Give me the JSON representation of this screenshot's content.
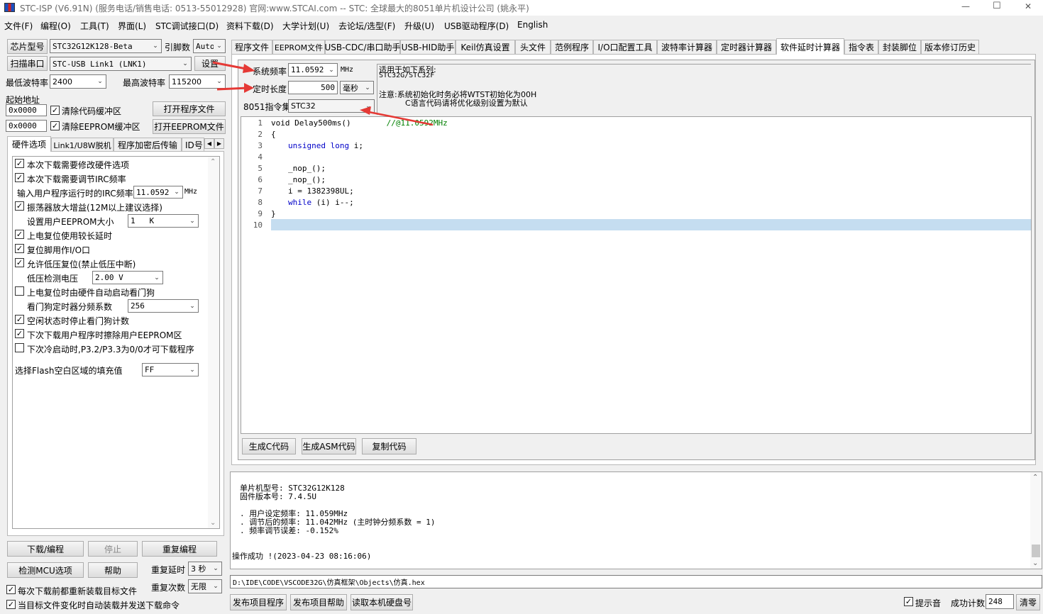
{
  "window": {
    "title": "STC-ISP (V6.91N) (服务电话/销售电话: 0513-55012928) 官网:www.STCAI.com  -- STC: 全球最大的8051单片机设计公司 (姚永平)",
    "minimize": "—",
    "maximize": "☐",
    "close": "✕"
  },
  "menu": [
    "文件(F)",
    "编程(O)",
    "工具(T)",
    "界面(L)",
    "STC调试接口(D)",
    "资料下载(D)",
    "大学计划(U)",
    "去论坛/选型(F)",
    "升级(U)",
    "USB驱动程序(D)",
    "English"
  ],
  "left": {
    "chip_label": "芯片型号",
    "chip_value": "STC32G12K128-Beta",
    "pin_label": "引脚数",
    "pin_value": "Auto",
    "scan_label": "扫描串口",
    "port_value": "STC-USB Link1 (LNK1)",
    "settings_label": "设置",
    "min_baud_label": "最低波特率",
    "min_baud": "2400",
    "max_baud_label": "最高波特率",
    "max_baud": "115200",
    "start_addr_label": "起始地址",
    "addr1": "0x0000",
    "clear_code": "清除代码缓冲区",
    "open_program": "打开程序文件",
    "addr2": "0x0000",
    "clear_eeprom": "清除EEPROM缓冲区",
    "open_eeprom": "打开EEPROM文件",
    "tabs": [
      "硬件选项",
      "Link1/U8W脱机",
      "程序加密后传输",
      "ID号"
    ],
    "options": [
      {
        "label": "本次下载需要修改硬件选项",
        "checked": true
      },
      {
        "label": "本次下载需要调节IRC频率",
        "checked": true
      },
      {
        "label": "输入用户程序运行时的IRC频率",
        "value": "11.0592",
        "unit": "MHz"
      },
      {
        "label": "振荡器放大增益(12M以上建议选择)",
        "checked": true
      },
      {
        "label": "设置用户EEPROM大小",
        "value": "1   K"
      },
      {
        "label": "上电复位使用较长延时",
        "checked": true
      },
      {
        "label": "复位脚用作I/O口",
        "checked": true
      },
      {
        "label": "允许低压复位(禁止低压中断)",
        "checked": true
      },
      {
        "label": "低压检测电压",
        "value": "2.00 V"
      },
      {
        "label": "上电复位时由硬件自动启动看门狗",
        "checked": false
      },
      {
        "label": "看门狗定时器分频系数",
        "value": "256"
      },
      {
        "label": "空闲状态时停止看门狗计数",
        "checked": true
      },
      {
        "label": "下次下载用户程序时擦除用户EEPROM区",
        "checked": true
      },
      {
        "label": "下次冷启动时,P3.2/P3.3为0/0才可下载程序",
        "checked": false
      }
    ],
    "flash_fill_label": "选择Flash空白区域的填充值",
    "flash_fill_value": "FF",
    "download_btn": "下载/编程",
    "stop_btn": "停止",
    "reprogram_btn": "重复编程",
    "detect_btn": "检测MCU选项",
    "help_btn": "帮助",
    "repeat_delay_label": "重复延时",
    "repeat_delay": "3 秒",
    "repeat_count_label": "重复次数",
    "repeat_count": "无限",
    "reload_each": "每次下载前都重新装载目标文件",
    "auto_send": "当目标文件变化时自动装载并发送下载命令"
  },
  "tabs": [
    "程序文件",
    "EEPROM文件",
    "USB-CDC/串口助手",
    "USB-HID助手",
    "Keil仿真设置",
    "头文件",
    "范例程序",
    "I/O口配置工具",
    "波特率计算器",
    "定时器计算器",
    "软件延时计算器",
    "指令表",
    "封装脚位",
    "版本修订历史"
  ],
  "delay": {
    "sysfreq_label": "系统频率",
    "sysfreq": "11.0592",
    "sysfreq_unit": "MHz",
    "len_label": "定时长度",
    "len": "500",
    "len_unit": "毫秒",
    "isa_label": "8051指令集",
    "isa": "STC32",
    "note1": "适用于如下系列:",
    "note2": "STC32G/STC32F",
    "note3": "注意:系统初始化时务必将WTST初始化为00H",
    "note4": "C语言代码请将优化级别设置为默认",
    "gen_c": "生成C代码",
    "gen_asm": "生成ASM代码",
    "copy": "复制代码"
  },
  "code": {
    "line_numbers": [
      "1",
      "2",
      "3",
      "4",
      "5",
      "6",
      "7",
      "8",
      "9",
      "10"
    ],
    "l1a": "void Delay500ms()",
    "l1b": "//@11.0592MHz",
    "l2": "{",
    "l3kw": "unsigned long",
    "l3": " i;",
    "l5": "_nop_();",
    "l6": "_nop_();",
    "l7": "i = 1382398UL;",
    "l8kw": "while",
    "l8": " (i) i--;",
    "l9": "}"
  },
  "log": {
    "chip_model": "单片机型号: STC32G12K128",
    "fw": "固件版本号: 7.4.5U",
    "user_freq": ". 用户设定频率: 11.059MHz",
    "adj_freq": ". 调节后的频率: 11.042MHz (主时钟分频系数 = 1)",
    "freq_err": ". 频率调节误差: -0.152%",
    "status": "操作成功 !(2023-04-23 08:16:06)"
  },
  "filepath": "D:\\IDE\\CODE\\VSCODE32G\\仿真框架\\Objects\\仿真.hex",
  "bottom": {
    "publish_prog": "发布项目程序",
    "publish_help": "发布项目帮助",
    "read_disk": "读取本机硬盘号",
    "beep": "提示音",
    "success_label": "成功计数",
    "success_count": "248",
    "clear": "清零"
  },
  "colors": {
    "arrow": "#e53935",
    "highlight": "#c5ddf0",
    "keyword": "#0000c8",
    "comment": "#008000"
  }
}
